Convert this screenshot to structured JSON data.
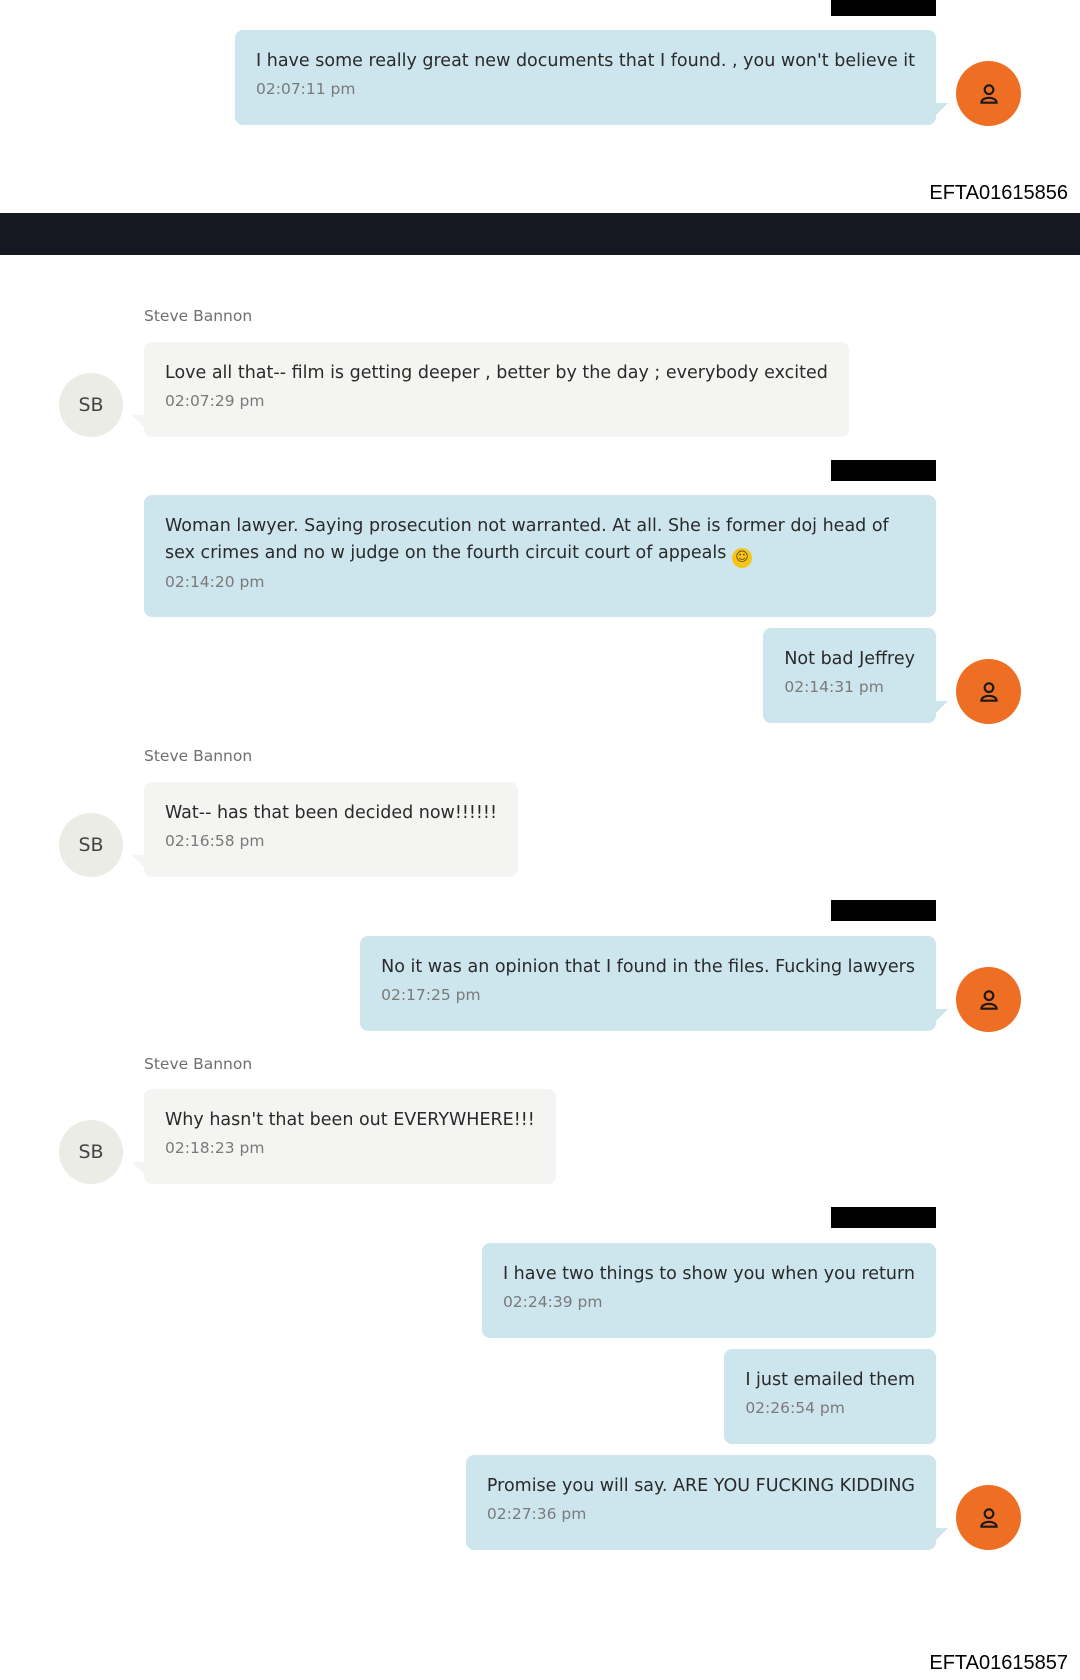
{
  "messages": {
    "m1": {
      "text": "I have some really great new documents that I found. , you won't believe it",
      "time": "02:07:11 pm"
    },
    "m2": {
      "sender": "Steve Bannon",
      "initials": "SB",
      "text": "Love all that-- film is getting deeper , better by the day ; everybody excited",
      "time": "02:07:29 pm"
    },
    "m3": {
      "text": "Woman lawyer. Saying prosecution not warranted. At all.   She is former doj head of sex crimes and no w judge on the fourth circuit court of appeals",
      "emoji": "☺",
      "time": "02:14:20 pm"
    },
    "m4": {
      "text": "Not bad Jeffrey",
      "time": "02:14:31 pm"
    },
    "m5": {
      "sender": "Steve Bannon",
      "initials": "SB",
      "text": "Wat-- has that been decided now!!!!!!",
      "time": "02:16:58 pm"
    },
    "m6": {
      "text": "No it was an opinion that I found in the files.  Fucking lawyers",
      "time": "02:17:25 pm"
    },
    "m7": {
      "sender": "Steve Bannon",
      "initials": "SB",
      "text": "Why hasn't that been out EVERYWHERE!!!",
      "time": "02:18:23 pm"
    },
    "m8": {
      "text": "I have two things to show you when you return",
      "time": "02:24:39 pm"
    },
    "m9": {
      "text": "I just emailed them",
      "time": "02:26:54 pm"
    },
    "m10": {
      "text": "Promise you will say. ARE YOU FUCKING KIDDING",
      "time": "02:27:36 pm"
    }
  },
  "doc_ids": {
    "page1": "EFTA01615856",
    "page2": "EFTA01615857"
  },
  "icons": {
    "user_avatar": "person-icon"
  },
  "colors": {
    "outgoing_bubble": "#cde6ee",
    "incoming_bubble": "#f4f4f2",
    "avatar_orange": "#ee6e23",
    "band": "#161821"
  }
}
